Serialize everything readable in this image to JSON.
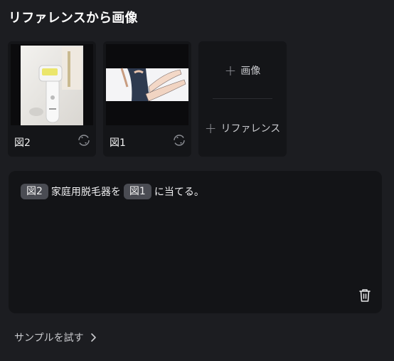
{
  "header": {
    "title": "リファレンスから画像"
  },
  "references": [
    {
      "label": "図2",
      "thumb_desc": "hair-removal-device-photo"
    },
    {
      "label": "図1",
      "thumb_desc": "illustration-legs"
    }
  ],
  "add_panel": {
    "image_label": "画像",
    "reference_label": "リファレンス"
  },
  "prompt": {
    "tag_a": "図2",
    "text_a": "家庭用脱毛器を",
    "tag_b": "図1",
    "text_b": "に当てる。"
  },
  "footer": {
    "sample_label": "サンプルを試す"
  },
  "colors": {
    "background": "#1c1d21",
    "card": "#141518",
    "tag": "#4a4c53"
  }
}
